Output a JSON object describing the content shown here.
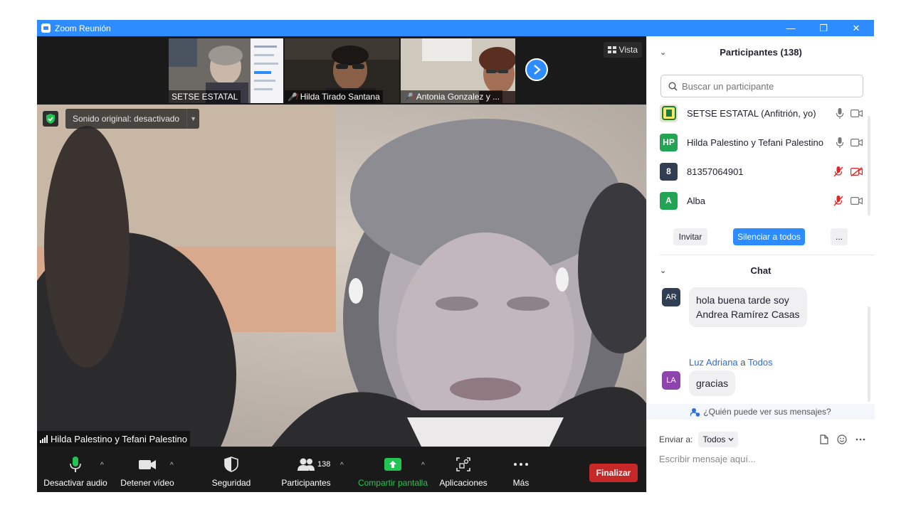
{
  "window": {
    "title": "Zoom Reunión",
    "minimize": "—",
    "restore": "❐",
    "close": "✕"
  },
  "video": {
    "view_label": "Vista",
    "original_sound": "Sonido original: desactivado",
    "active_speaker": "Hilda Palestino y Tefani  Palestino",
    "thumbnails": [
      {
        "name": "SETSE ESTATAL",
        "muted": false
      },
      {
        "name": "Hilda Tirado Santana",
        "muted": true
      },
      {
        "name": "Antonia Gonzalez y ...",
        "muted": true
      }
    ]
  },
  "toolbar": {
    "audio": "Desactivar audio",
    "video": "Detener vídeo",
    "security": "Seguridad",
    "participants": "Participantes",
    "participants_count": "138",
    "share": "Compartir pantalla",
    "apps": "Aplicaciones",
    "more": "Más",
    "end": "Finalizar"
  },
  "participants_panel": {
    "title": "Participantes (138)",
    "search_placeholder": "Buscar un participante",
    "list": [
      {
        "initials": "",
        "name": "SETSE ESTATAL (Anfitrión, yo)",
        "color": "#e8e4c8",
        "mic_muted": false,
        "cam_off": false
      },
      {
        "initials": "HP",
        "name": "Hilda Palestino y Tefani  Palestino",
        "color": "#23a455",
        "mic_muted": false,
        "cam_off": false
      },
      {
        "initials": "8",
        "name": "81357064901",
        "color": "#2f3e52",
        "mic_muted": true,
        "cam_off": true
      },
      {
        "initials": "A",
        "name": "Alba",
        "color": "#23a455",
        "mic_muted": true,
        "cam_off": false
      }
    ],
    "invite": "Invitar",
    "mute_all": "Silenciar a todos",
    "more": "..."
  },
  "chat": {
    "title": "Chat",
    "messages": [
      {
        "initials": "AR",
        "color": "#2f3e52",
        "sender": "",
        "to_word": "",
        "recipient": "",
        "line1": "hola buena tarde soy",
        "line2": "Andrea Ramírez Casas"
      },
      {
        "initials": "LA",
        "color": "#8e44ad",
        "sender": "Luz Adriana",
        "to_word": "a",
        "recipient": "Todos",
        "line1": "gracias",
        "line2": ""
      }
    ],
    "who_can_see": "¿Quién puede ver sus mensajes?",
    "send_to_label": "Enviar a:",
    "send_to_value": "Todos",
    "compose_placeholder": "Escribir mensaje aquí..."
  },
  "colors": {
    "accent": "#2d8cff",
    "end_red": "#c62828",
    "share_green": "#23c552",
    "chat_link": "#2d6fd6"
  }
}
